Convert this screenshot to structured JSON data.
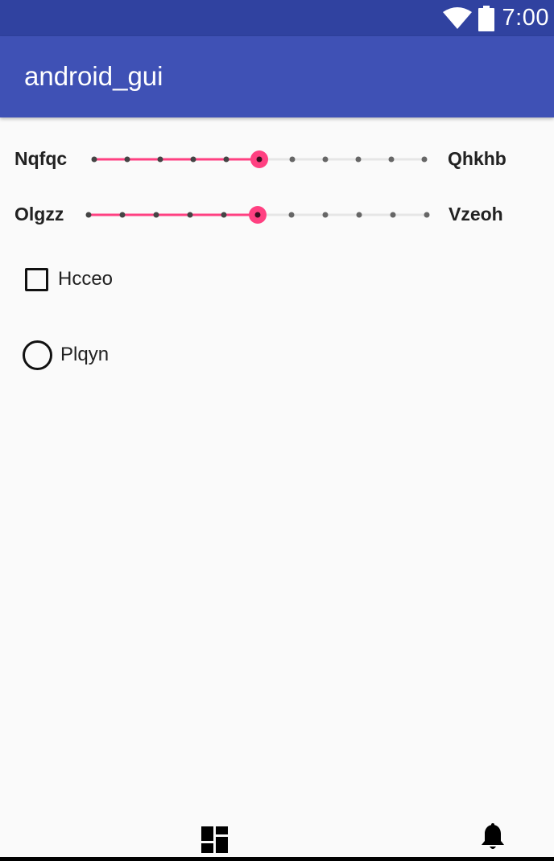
{
  "status_bar": {
    "time": "7:00",
    "icons": [
      "wifi-icon",
      "battery-icon"
    ],
    "color": "#3042a0"
  },
  "app_bar": {
    "title": "android_gui",
    "color": "#3f51b5"
  },
  "sliders": [
    {
      "left_label": "Nqfqc",
      "right_label": "Qhkhb",
      "steps": 10,
      "value": 5,
      "accent": "#ff4081"
    },
    {
      "left_label": "Olgzz",
      "right_label": "Vzeoh",
      "steps": 10,
      "value": 5,
      "accent": "#ff4081"
    }
  ],
  "checkbox": {
    "label": "Hcceo",
    "checked": false
  },
  "radio": {
    "label": "Plqyn",
    "selected": false
  },
  "bottom_nav": {
    "icons": [
      "dashboard-icon",
      "notifications-icon"
    ]
  }
}
